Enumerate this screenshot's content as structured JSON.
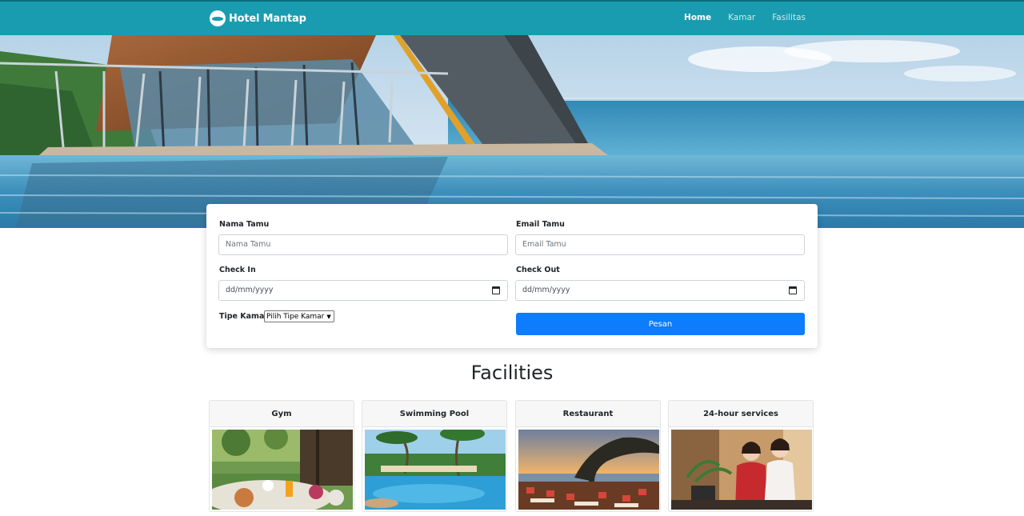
{
  "navbar": {
    "brand": "Hotel Mantap",
    "links": [
      {
        "label": "Home",
        "active": true
      },
      {
        "label": "Kamar",
        "active": false
      },
      {
        "label": "Fasilitas",
        "active": false
      }
    ]
  },
  "booking_form": {
    "guest_name": {
      "label": "Nama Tamu",
      "placeholder": "Nama Tamu"
    },
    "guest_email": {
      "label": "Email Tamu",
      "placeholder": "Email Tamu"
    },
    "check_in": {
      "label": "Check In",
      "value": "dd/mm/yyyy"
    },
    "check_out": {
      "label": "Check Out",
      "value": "dd/mm/yyyy"
    },
    "room_type": {
      "label": "Tipe Kamar",
      "selected": "Pilih Tipe Kamar"
    },
    "submit_label": "Pesan"
  },
  "facilities": {
    "title": "Facilities",
    "items": [
      {
        "name": "Gym"
      },
      {
        "name": "Swimming Pool"
      },
      {
        "name": "Restaurant"
      },
      {
        "name": "24-hour services"
      }
    ]
  },
  "colors": {
    "navbar": "#1a9cb0",
    "primary_button": "#0d7cfd"
  }
}
